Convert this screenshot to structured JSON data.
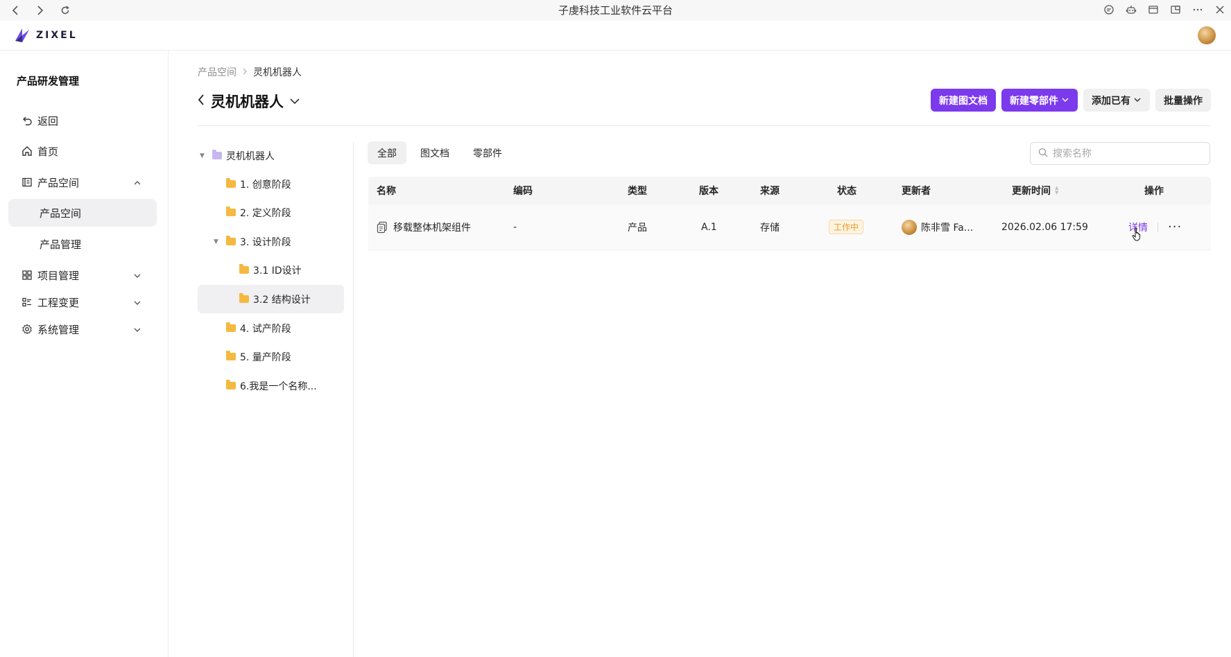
{
  "window": {
    "title": "子虔科技工业软件云平台"
  },
  "app": {
    "logo_text": "ZIXEL"
  },
  "sidebar": {
    "title": "产品研发管理",
    "items": [
      {
        "label": "返回"
      },
      {
        "label": "首页"
      },
      {
        "label": "产品空间"
      },
      {
        "label": "产品空间"
      },
      {
        "label": "产品管理"
      },
      {
        "label": "项目管理"
      },
      {
        "label": "工程变更"
      },
      {
        "label": "系统管理"
      }
    ]
  },
  "breadcrumb": {
    "root": "产品空间",
    "current": "灵机机器人"
  },
  "page": {
    "title": "灵机机器人"
  },
  "actions": {
    "new_drawing": "新建图文档",
    "new_part": "新建零部件",
    "add_existing": "添加已有",
    "batch": "批量操作"
  },
  "tree": {
    "nodes": [
      {
        "label": "灵机机器人"
      },
      {
        "label": "1. 创意阶段"
      },
      {
        "label": "2. 定义阶段"
      },
      {
        "label": "3. 设计阶段"
      },
      {
        "label": "3.1 ID设计"
      },
      {
        "label": "3.2 结构设计"
      },
      {
        "label": "4. 试产阶段"
      },
      {
        "label": "5. 量产阶段"
      },
      {
        "label": "6.我是一个名称..."
      }
    ]
  },
  "tabs": [
    {
      "label": "全部"
    },
    {
      "label": "图文档"
    },
    {
      "label": "零部件"
    }
  ],
  "search": {
    "placeholder": "搜索名称"
  },
  "table": {
    "headers": {
      "name": "名称",
      "code": "编码",
      "type": "类型",
      "version": "版本",
      "source": "来源",
      "status": "状态",
      "updater": "更新者",
      "updated": "更新时间",
      "ops": "操作"
    },
    "rows": [
      {
        "name": "移载整体机架组件",
        "code": "-",
        "type": "产品",
        "version": "A.1",
        "source": "存储",
        "status": "工作中",
        "updater": "陈非雪 Fa...",
        "updated": "2026.02.06 17:59",
        "detail": "详情",
        "more": "···"
      }
    ]
  },
  "colors": {
    "accent": "#7c3aed",
    "status_working": "#e59b2a",
    "folder": "#f5b940"
  }
}
